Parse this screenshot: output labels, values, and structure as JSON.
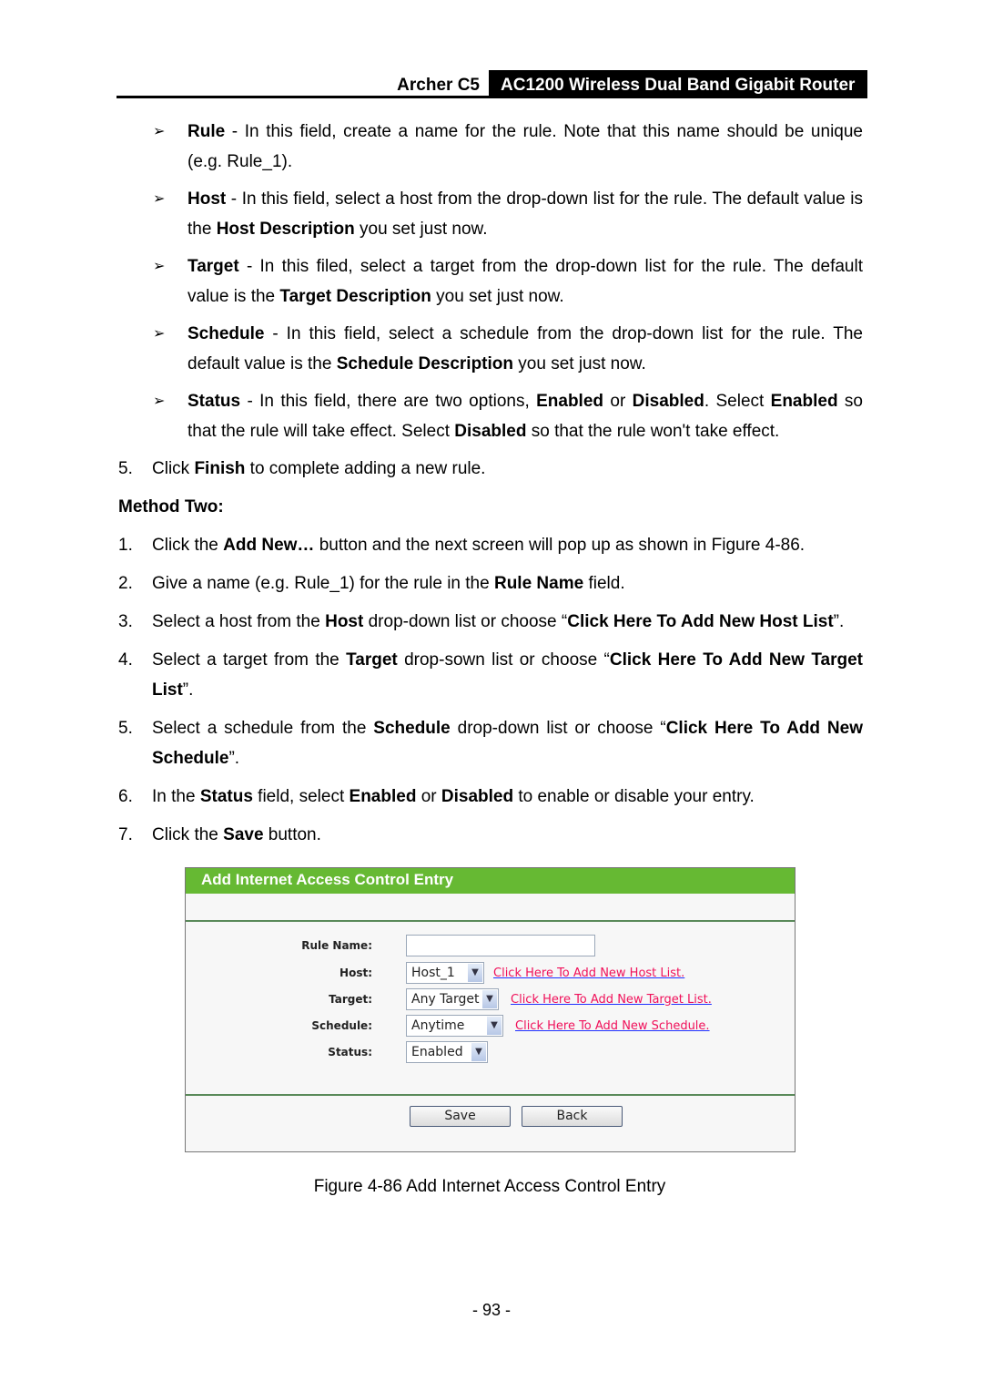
{
  "header": {
    "model": "Archer C5",
    "product": "AC1200 Wireless Dual Band Gigabit Router"
  },
  "bullets": [
    [
      {
        "t": "Rule",
        "b": 1
      },
      {
        "t": " - In this field, create a name for the rule. Note that this name should be unique (e.g. Rule_1)."
      }
    ],
    [
      {
        "t": "Host",
        "b": 1
      },
      {
        "t": " - In this field, select a host from the drop-down list for the rule. The default value is the "
      },
      {
        "t": "Host Description",
        "b": 1
      },
      {
        "t": " you set just now."
      }
    ],
    [
      {
        "t": "Target",
        "b": 1
      },
      {
        "t": " - In this filed, select a target from the drop-down list for the rule. The default value is the "
      },
      {
        "t": "Target Description",
        "b": 1
      },
      {
        "t": " you set just now."
      }
    ],
    [
      {
        "t": "Schedule",
        "b": 1
      },
      {
        "t": " - In this field, select a schedule from the drop-down list for the rule. The default value is the "
      },
      {
        "t": "Schedule Description",
        "b": 1
      },
      {
        "t": " you set just now."
      }
    ],
    [
      {
        "t": "Status",
        "b": 1
      },
      {
        "t": " - In this field, there are two options, "
      },
      {
        "t": "Enabled",
        "b": 1
      },
      {
        "t": " or "
      },
      {
        "t": "Disabled",
        "b": 1
      },
      {
        "t": ". Select "
      },
      {
        "t": "Enabled",
        "b": 1
      },
      {
        "t": " so that the rule will take effect. Select "
      },
      {
        "t": "Disabled",
        "b": 1
      },
      {
        "t": " so that the rule won't take effect."
      }
    ]
  ],
  "step5": {
    "n": "5.",
    "segs": [
      {
        "t": "Click "
      },
      {
        "t": "Finish",
        "b": 1
      },
      {
        "t": " to complete adding a new rule."
      }
    ]
  },
  "method_two": "Method Two:",
  "steps": [
    {
      "n": "1.",
      "segs": [
        {
          "t": "Click the "
        },
        {
          "t": "Add New…",
          "b": 1
        },
        {
          "t": " button and the next screen will pop up as shown in Figure 4-86."
        }
      ]
    },
    {
      "n": "2.",
      "segs": [
        {
          "t": "Give a name (e.g. Rule_1) for the rule in the "
        },
        {
          "t": "Rule Name",
          "b": 1
        },
        {
          "t": " field."
        }
      ]
    },
    {
      "n": "3.",
      "segs": [
        {
          "t": "Select a host from the "
        },
        {
          "t": "Host",
          "b": 1
        },
        {
          "t": " drop-down list or choose “"
        },
        {
          "t": "Click Here To Add New Host List",
          "b": 1
        },
        {
          "t": "”."
        }
      ]
    },
    {
      "n": "4.",
      "segs": [
        {
          "t": "Select a target from the "
        },
        {
          "t": "Target",
          "b": 1
        },
        {
          "t": " drop-sown list or choose “"
        },
        {
          "t": "Click Here To Add New Target List",
          "b": 1
        },
        {
          "t": "”."
        }
      ]
    },
    {
      "n": "5.",
      "segs": [
        {
          "t": "Select a schedule from the "
        },
        {
          "t": "Schedule",
          "b": 1
        },
        {
          "t": " drop-down list or choose “"
        },
        {
          "t": "Click Here To Add New Schedule",
          "b": 1
        },
        {
          "t": "”."
        }
      ]
    },
    {
      "n": "6.",
      "segs": [
        {
          "t": "In the "
        },
        {
          "t": "Status",
          "b": 1
        },
        {
          "t": " field, select "
        },
        {
          "t": "Enabled",
          "b": 1
        },
        {
          "t": " or "
        },
        {
          "t": "Disabled",
          "b": 1
        },
        {
          "t": " to enable or disable your entry."
        }
      ]
    },
    {
      "n": "7.",
      "segs": [
        {
          "t": "Click the "
        },
        {
          "t": "Save",
          "b": 1
        },
        {
          "t": " button."
        }
      ]
    }
  ],
  "figure": {
    "title": "Add Internet Access Control Entry",
    "accent": "#66b933",
    "rule_name_label": "Rule Name:",
    "rule_name_value": "",
    "host_label": "Host:",
    "host_value": "Host_1",
    "host_link": "Click Here To Add New Host List.",
    "target_label": "Target:",
    "target_value": "Any Target",
    "target_link": "Click Here To Add New Target List.",
    "schedule_label": "Schedule:",
    "schedule_value": "Anytime",
    "schedule_link": "Click Here To Add New Schedule.",
    "status_label": "Status:",
    "status_value": "Enabled",
    "save": "Save",
    "back": "Back"
  },
  "caption": "Figure 4-86 Add Internet Access Control Entry",
  "page_number": "- 93 -"
}
